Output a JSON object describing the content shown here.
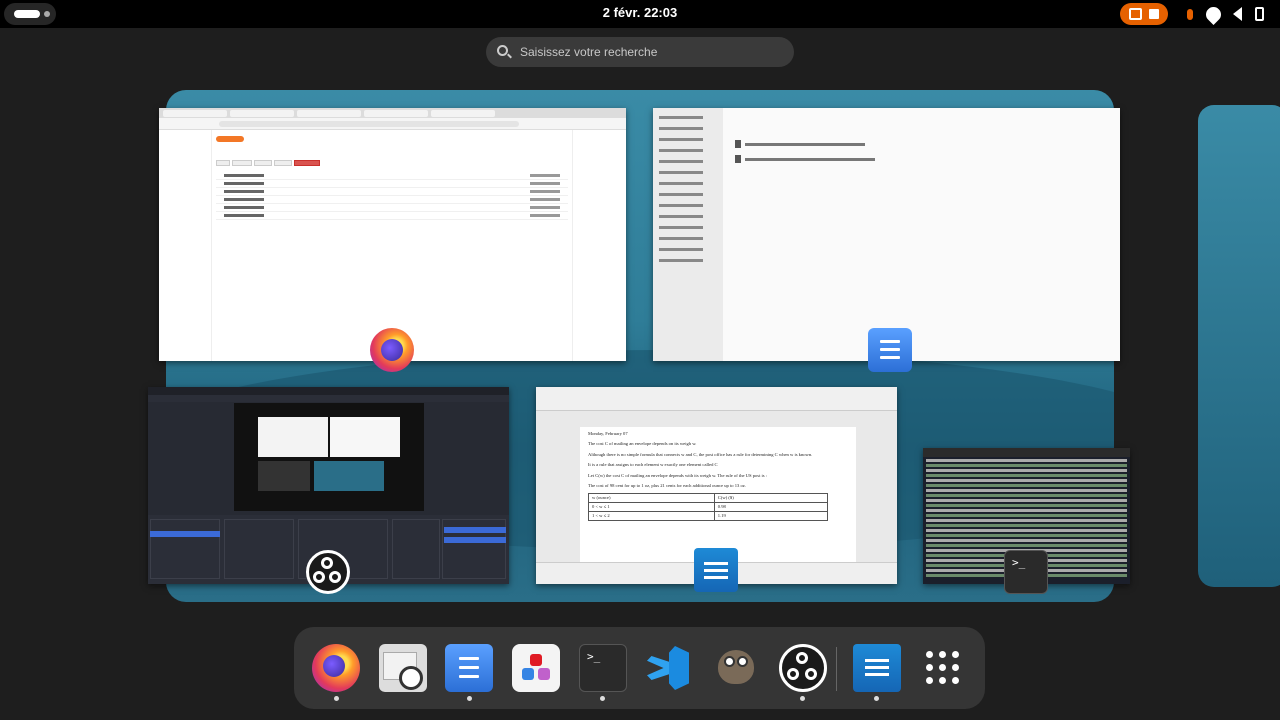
{
  "topbar": {
    "clock": "2 févr.  22:03",
    "accent_color": "#e66100"
  },
  "search": {
    "placeholder": "Saisissez votre recherche"
  },
  "windows": [
    {
      "name": "firefox-jupyter",
      "app_icon": "firefox-icon"
    },
    {
      "name": "files-calcul",
      "app_icon": "files-icon"
    },
    {
      "name": "obs-studio",
      "app_icon": "obs-icon"
    },
    {
      "name": "libreoffice-writer",
      "app_icon": "writer-icon"
    },
    {
      "name": "terminal",
      "app_icon": "terminal-icon"
    }
  ],
  "writer_doc": {
    "date": "Monday, February 07",
    "p1": "The cost C of mailing an envelope depends on its weigh w.",
    "p2": "Although there is no simple formula that connects w and C, the post office has a rule for determining C when w is known.",
    "p3": "It is a rule that assigns to each element w  exactly one element called C",
    "p4": "Let C(w)  the cost C of mailing an envelope depends with its weigh w. The rule of the US post is :",
    "p5": "The cost of 98 cent for up to 1 oz, plus 21 cents for each additional ounce up to 13 oz.",
    "table_headers": [
      "w (ounce)",
      "C(w) ($)"
    ],
    "table_rows": [
      [
        "0 < w ≤ 1",
        "0.98"
      ],
      [
        "1 < w ≤ 2",
        "1.19"
      ]
    ]
  },
  "dash": {
    "items": [
      {
        "icon": "firefox-icon",
        "running": true
      },
      {
        "icon": "mail-clock-icon",
        "running": false
      },
      {
        "icon": "files-icon",
        "running": true
      },
      {
        "icon": "software-store-icon",
        "running": false
      },
      {
        "icon": "terminal-icon",
        "running": true
      },
      {
        "icon": "vscode-icon",
        "running": false
      },
      {
        "icon": "gimp-icon",
        "running": false
      },
      {
        "icon": "obs-icon",
        "running": true
      },
      {
        "icon": "writer-icon",
        "running": true
      },
      {
        "icon": "app-grid-icon",
        "running": false
      }
    ]
  },
  "terminal_prompt": ">_"
}
